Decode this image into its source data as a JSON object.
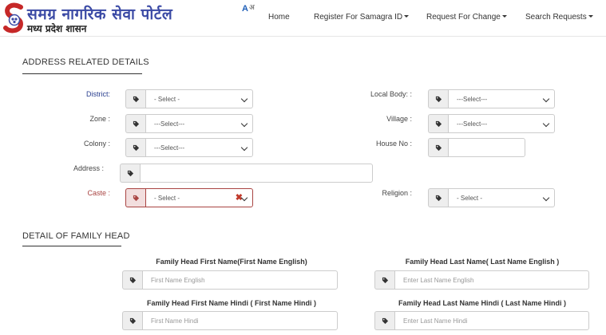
{
  "header": {
    "title": "समग्र नागरिक सेवा पोर्टल",
    "subtitle": "मध्य प्रदेश शासन",
    "font_toggle": "A",
    "font_toggle_alt": "अ",
    "nav": {
      "home": "Home",
      "register": "Register For Samagra ID",
      "change": "Request For Change",
      "search": "Search Requests"
    }
  },
  "address_section": {
    "title": "ADDRESS RELATED DETAILS",
    "district": {
      "label": "District:",
      "value": "- Select -"
    },
    "local_body": {
      "label": "Local Body: :",
      "value": "---Select---"
    },
    "zone": {
      "label": "Zone :",
      "value": "---Select---"
    },
    "village": {
      "label": "Village :",
      "value": "---Select---"
    },
    "colony": {
      "label": "Colony :",
      "value": "---Select---"
    },
    "house_no": {
      "label": "House No :",
      "value": ""
    },
    "address": {
      "label": "Address :",
      "value": ""
    },
    "caste": {
      "label": "Caste :",
      "value": "- Select -"
    },
    "religion": {
      "label": "Religion :",
      "value": "- Select -"
    }
  },
  "family_section": {
    "title": "DETAIL OF FAMILY HEAD",
    "first_name_en": {
      "label": "Family Head First Name(First Name English)",
      "placeholder": "First Name English"
    },
    "last_name_en": {
      "label": "Family Head Last Name( Last Name English )",
      "placeholder": "Enter  Last Name English"
    },
    "first_name_hi": {
      "label": "Family Head First Name Hindi ( First Name Hindi )",
      "placeholder": "First Name Hindi"
    },
    "last_name_hi": {
      "label": "Family Head Last Name Hindi ( Last Name Hindi )",
      "placeholder": "Enter  Last Name Hindi"
    }
  },
  "colors": {
    "brand": "#3b4aa5",
    "error": "#a94442",
    "label_blue": "#2a3f8f"
  },
  "icons": {
    "logo": "samagra-logo-icon",
    "field_addon": "tag-icon",
    "select_arrow": "chevron-down-icon",
    "error_mark": "close-icon"
  }
}
